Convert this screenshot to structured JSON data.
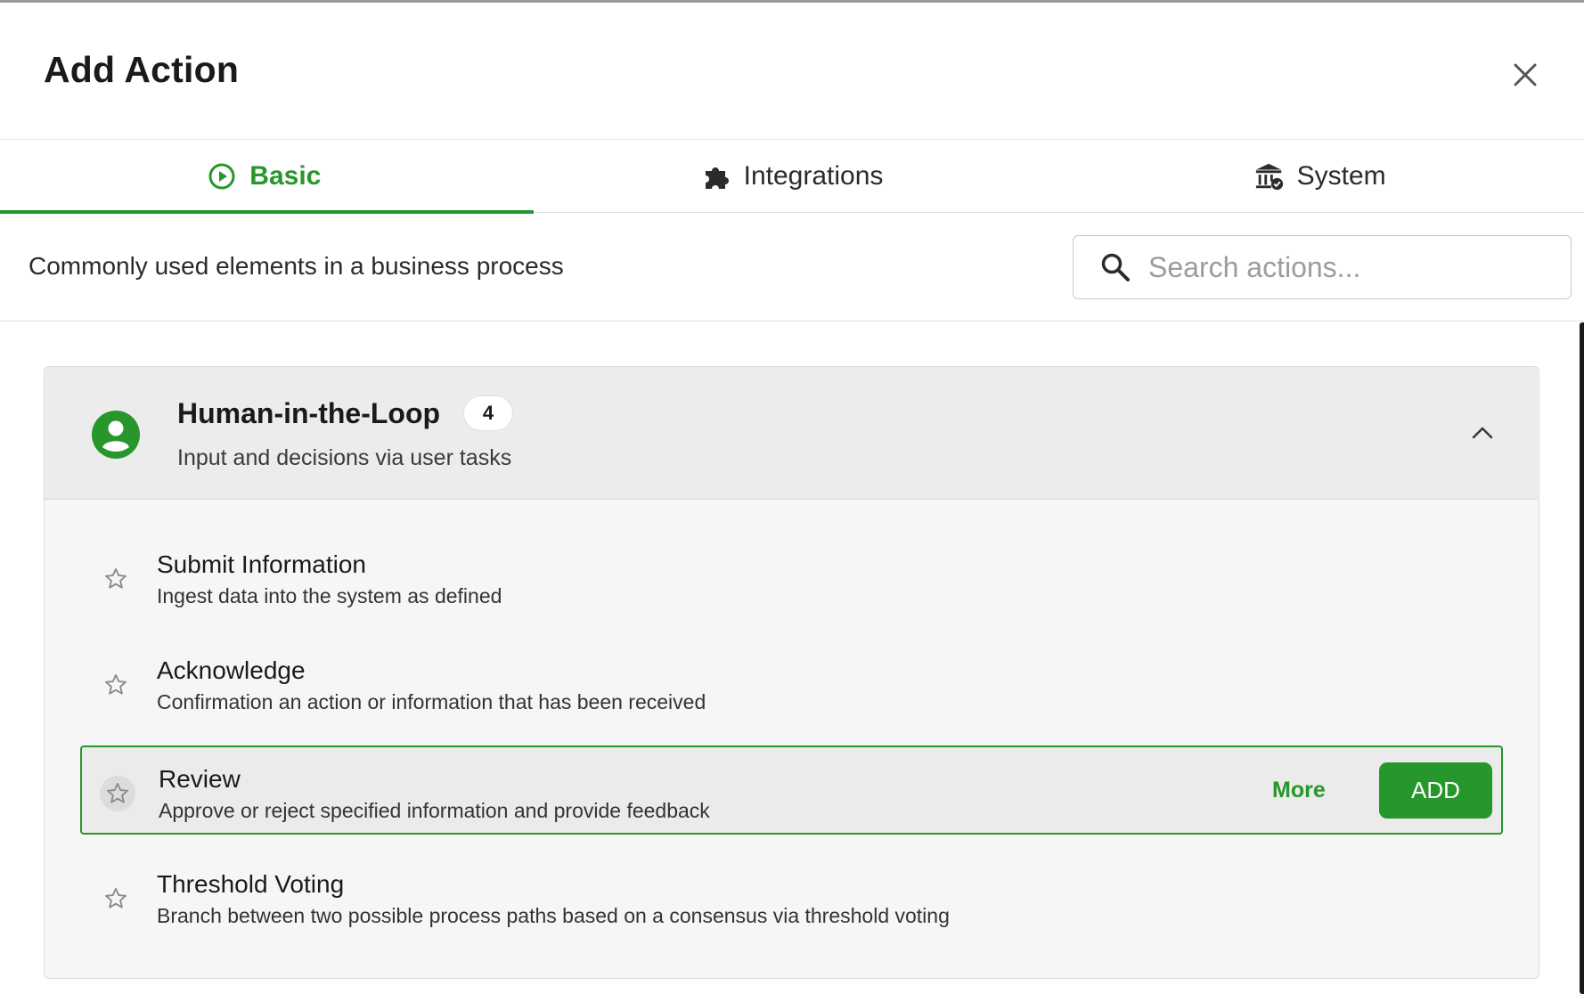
{
  "dialog": {
    "title": "Add Action",
    "close_icon": "close-icon"
  },
  "tabs": [
    {
      "label": "Basic",
      "icon": "play-circle-icon",
      "active": true
    },
    {
      "label": "Integrations",
      "icon": "puzzle-icon",
      "active": false
    },
    {
      "label": "System",
      "icon": "bank-check-icon",
      "active": false
    }
  ],
  "subheader": {
    "text": "Commonly used elements in a business process",
    "search_placeholder": "Search actions...",
    "search_value": ""
  },
  "group": {
    "title": "Human-in-the-Loop",
    "count": "4",
    "subtitle": "Input and decisions via user tasks",
    "icon": "user-circle-icon",
    "expanded": true,
    "items": [
      {
        "title": "Submit Information",
        "description": "Ingest data into the system as defined",
        "highlighted": false
      },
      {
        "title": "Acknowledge",
        "description": "Confirmation an action or information that has been received",
        "highlighted": false
      },
      {
        "title": "Review",
        "description": "Approve or reject specified information and provide feedback",
        "highlighted": true,
        "more_label": "More",
        "add_label": "ADD"
      },
      {
        "title": "Threshold Voting",
        "description": "Branch between two possible process paths based on a consensus via threshold voting",
        "highlighted": false
      }
    ]
  },
  "colors": {
    "accent": "#27962b",
    "header_bg": "#ececec",
    "panel_bg": "#f6f6f6"
  }
}
